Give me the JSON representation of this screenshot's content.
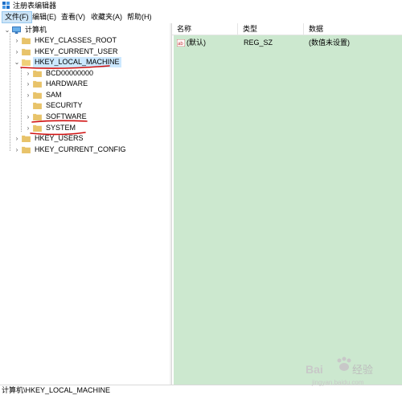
{
  "window": {
    "title": "注册表编辑器"
  },
  "menubar": {
    "items": [
      {
        "label": "文件(F)",
        "active": true
      },
      {
        "label": "编辑(E)",
        "active": false
      },
      {
        "label": "查看(V)",
        "active": false
      },
      {
        "label": "收藏夹(A)",
        "active": false
      },
      {
        "label": "帮助(H)",
        "active": false
      }
    ]
  },
  "tree": {
    "root": {
      "label": "计算机",
      "icon": "computer-icon",
      "expanded": true
    },
    "hives": [
      {
        "label": "HKEY_CLASSES_ROOT",
        "expanded": false
      },
      {
        "label": "HKEY_CURRENT_USER",
        "expanded": false
      },
      {
        "label": "HKEY_LOCAL_MACHINE",
        "expanded": true,
        "selected": true
      },
      {
        "label": "HKEY_USERS",
        "expanded": false
      },
      {
        "label": "HKEY_CURRENT_CONFIG",
        "expanded": false
      }
    ],
    "hklm_children": [
      {
        "label": "BCD00000000",
        "has_children": true
      },
      {
        "label": "HARDWARE",
        "has_children": true
      },
      {
        "label": "SAM",
        "has_children": true
      },
      {
        "label": "SECURITY",
        "has_children": false
      },
      {
        "label": "SOFTWARE",
        "has_children": true
      },
      {
        "label": "SYSTEM",
        "has_children": true
      }
    ]
  },
  "list": {
    "columns": {
      "name": "名称",
      "type": "类型",
      "data": "数据"
    },
    "rows": [
      {
        "name": "(默认)",
        "type": "REG_SZ",
        "data": "(数值未设置)",
        "icon": "string-value-icon"
      }
    ]
  },
  "statusbar": {
    "path": "计算机\\HKEY_LOCAL_MACHINE"
  },
  "watermark": {
    "brand": "Bai",
    "suffix": "经验",
    "url": "jingyan.baidu.com"
  },
  "colors": {
    "list_background": "#cce8cf",
    "selection": "#cce8ff",
    "annotation_red": "#d01010",
    "folder": "#e8c36a"
  }
}
